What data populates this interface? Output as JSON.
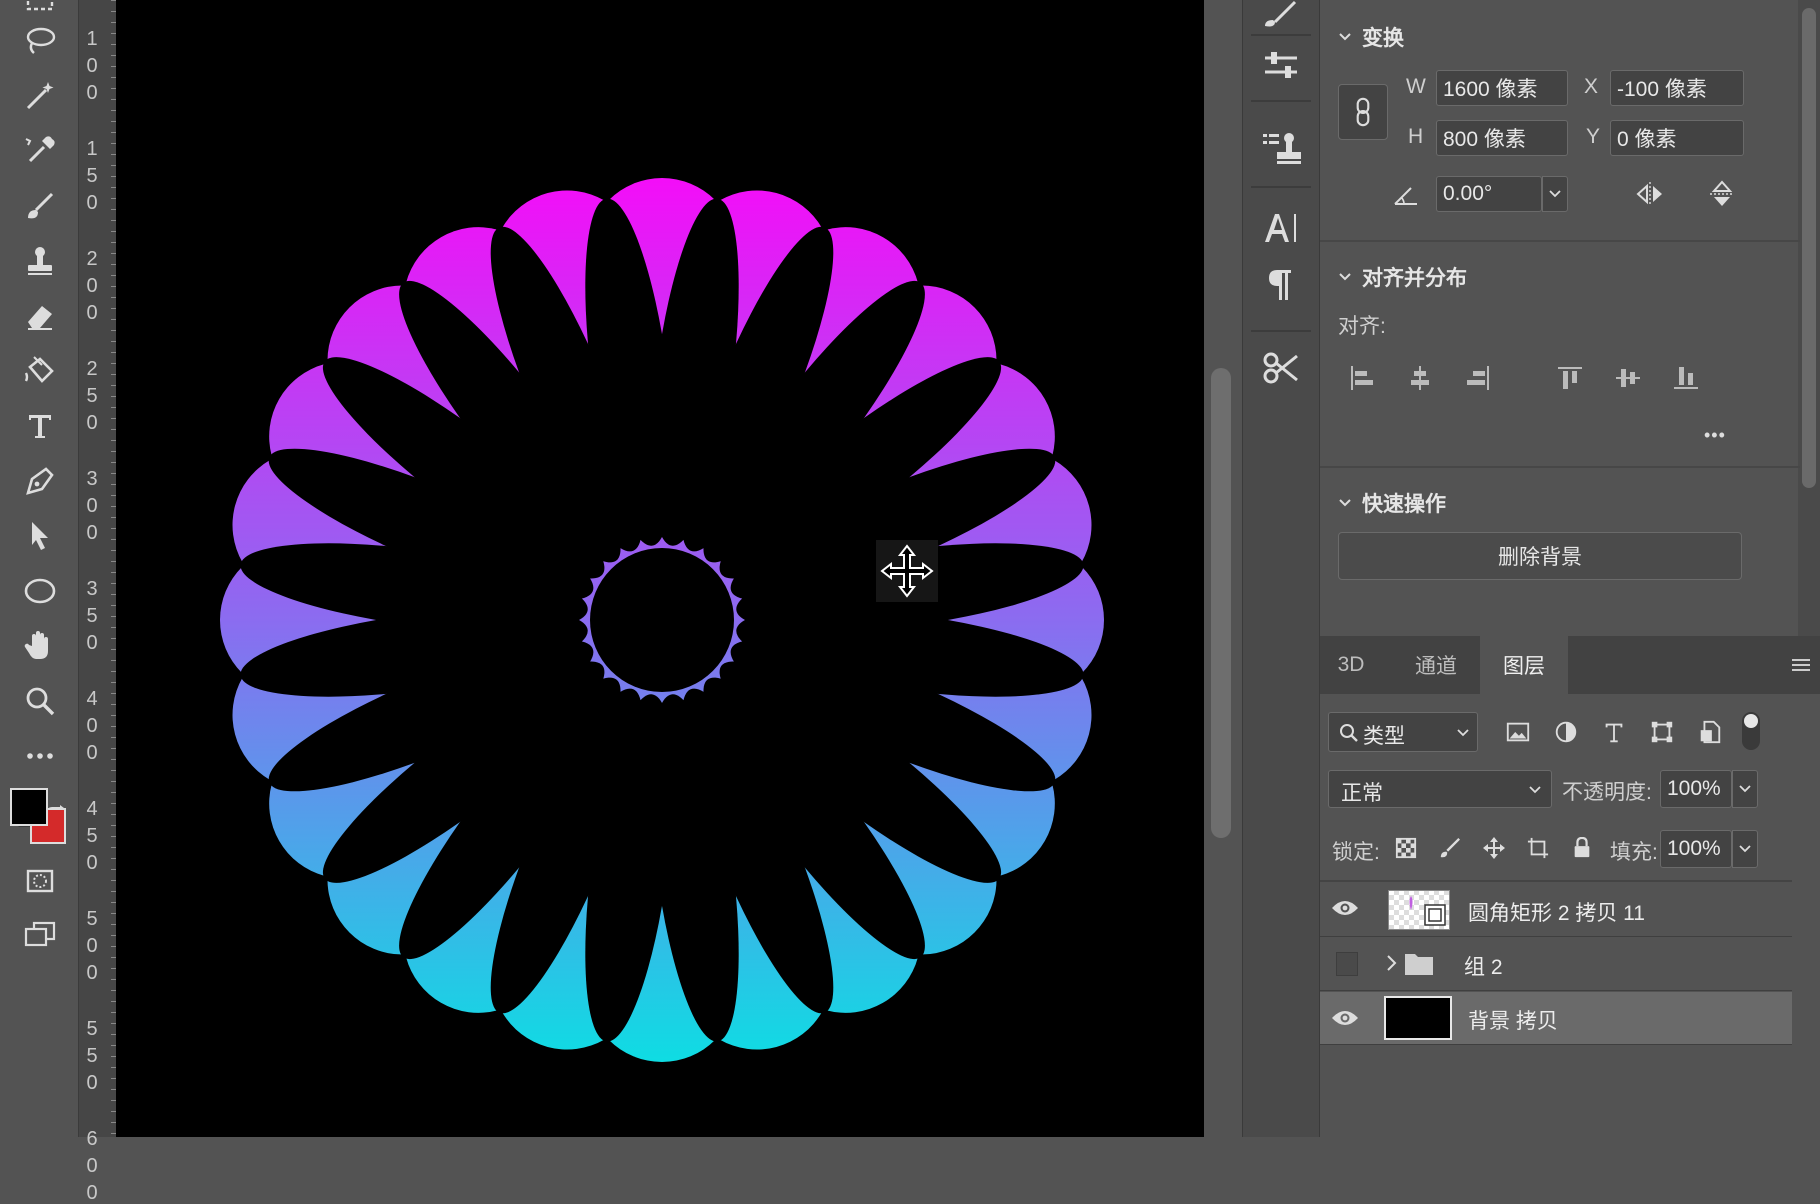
{
  "ruler": {
    "labels": [
      [
        "1",
        "0",
        "0"
      ],
      [
        "1",
        "5",
        "0"
      ],
      [
        "2",
        "0",
        "0"
      ],
      [
        "2",
        "5",
        "0"
      ],
      [
        "3",
        "0",
        "0"
      ],
      [
        "3",
        "5",
        "0"
      ],
      [
        "4",
        "0",
        "0"
      ],
      [
        "4",
        "5",
        "0"
      ],
      [
        "5",
        "0",
        "0"
      ],
      [
        "5",
        "5",
        "0"
      ],
      [
        "6",
        "0",
        "0"
      ]
    ]
  },
  "colors": {
    "foreground": "#000000",
    "background": "#d42a2a",
    "gradient_top": "#f30ef8",
    "gradient_mid": "#8b6cf0",
    "gradient_bottom": "#0fdce3"
  },
  "properties": {
    "transform": {
      "title": "变换",
      "w_label": "W",
      "w_value": "1600 像素",
      "x_label": "X",
      "x_value": "-100 像素",
      "h_label": "H",
      "h_value": "800 像素",
      "y_label": "Y",
      "y_value": "0 像素",
      "angle_value": "0.00°"
    },
    "align": {
      "title": "对齐并分布",
      "align_label": "对齐:",
      "more": "•••"
    },
    "quick": {
      "title": "快速操作",
      "remove_bg": "删除背景"
    }
  },
  "layers_panel": {
    "tabs": [
      "3D",
      "通道",
      "图层"
    ],
    "active_tab": "图层",
    "filter_value": "类型",
    "blend_mode": "正常",
    "opacity_label": "不透明度:",
    "opacity_value": "100%",
    "lock_label": "锁定:",
    "fill_label": "填充:",
    "fill_value": "100%",
    "layers": [
      {
        "name": "圆角矩形 2 拷贝 11",
        "visible": true,
        "type": "smart-shape"
      },
      {
        "name": "组 2",
        "visible": false,
        "type": "group"
      },
      {
        "name": "背景 拷贝",
        "visible": true,
        "type": "pixel",
        "selected": true
      }
    ]
  }
}
